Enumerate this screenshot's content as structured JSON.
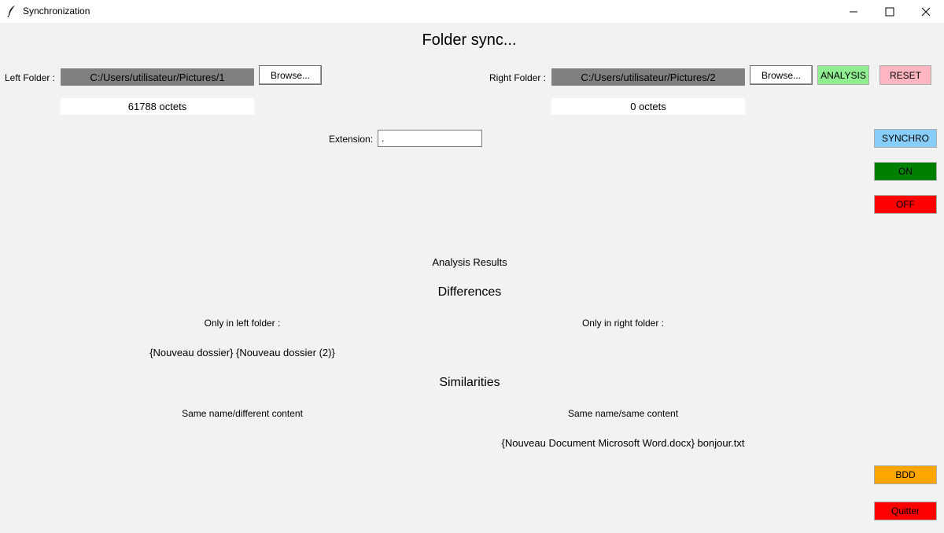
{
  "window": {
    "title": "Synchronization"
  },
  "header": {
    "title": "Folder sync..."
  },
  "left": {
    "label": "Left Folder :",
    "path": "C:/Users/utilisateur/Pictures/1",
    "browse_label": "Browse...",
    "size": "61788 octets"
  },
  "right": {
    "label": "Right Folder :",
    "path": "C:/Users/utilisateur/Pictures/2",
    "browse_label": "Browse...",
    "size": "0 octets"
  },
  "buttons": {
    "analysis": "ANALYSIS",
    "reset": "RESET",
    "synchro": "SYNCHRO",
    "on": "ON",
    "off": "OFF",
    "bdd": "BDD",
    "quit": "Quitter"
  },
  "extension": {
    "label": "Extension:",
    "value": "."
  },
  "results": {
    "title": "Analysis Results",
    "differences_title": "Differences",
    "only_left_label": "Only in left folder :",
    "only_right_label": "Only in right folder :",
    "only_left_value": "{Nouveau dossier} {Nouveau dossier (2)}",
    "only_right_value": "",
    "similarities_title": "Similarities",
    "same_name_diff_label": "Same name/different content",
    "same_name_same_label": "Same name/same content",
    "same_name_diff_value": "",
    "same_name_same_value": "{Nouveau Document Microsoft Word.docx} bonjour.txt"
  },
  "colors": {
    "analysis": "#90ee90",
    "reset": "#ffb6c1",
    "synchro": "#87cefa",
    "on": "#008000",
    "off": "#ff0000",
    "bdd": "#ffa500",
    "quit": "#ff0000",
    "path_bg": "#808080"
  },
  "icons": {
    "app": "feather-icon",
    "minimize": "minimize-icon",
    "maximize": "maximize-icon",
    "close": "close-icon"
  }
}
